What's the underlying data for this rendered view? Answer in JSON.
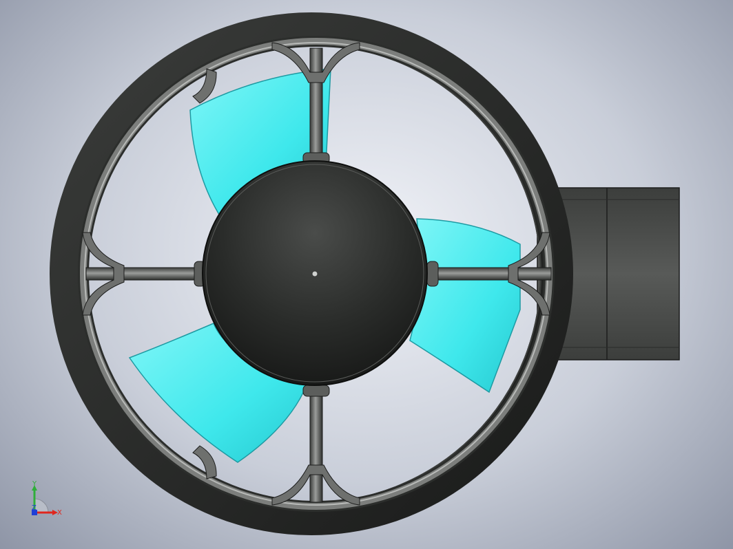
{
  "viewport": {
    "background_inner": "#f1f3f8",
    "background_outer": "#8e95a6"
  },
  "model": {
    "shroud_color": "#2b2d2b",
    "frame_color": "#6e706e",
    "hub_color": "#262826",
    "blade_color": "#4ff0f2",
    "motor_housing_color": "#4a4c4a",
    "blade_count": 3,
    "spoke_count": 4
  },
  "triad": {
    "x_label": "X",
    "y_label": "Y",
    "z_label": "Z",
    "x_color": "#e0261d",
    "y_color": "#2fae3a",
    "z_color": "#1f3fd6"
  }
}
